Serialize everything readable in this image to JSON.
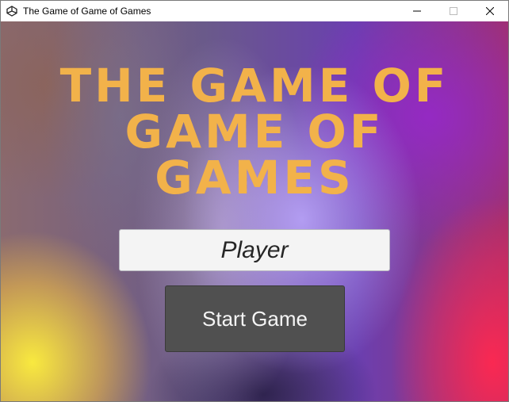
{
  "window": {
    "title": "The Game of Game of Games",
    "app_icon": "unity-icon",
    "controls": {
      "minimize_icon": "minimize-icon",
      "maximize_icon": "maximize-icon",
      "close_icon": "close-icon"
    }
  },
  "menu": {
    "title_lines": [
      "THE GAME OF",
      "GAME OF",
      "GAMES"
    ],
    "player_name_value": "Player",
    "start_button_label": "Start Game"
  },
  "colors": {
    "title_text": "#f2b24a",
    "button_bg": "#505050",
    "button_text": "#f5f5f5",
    "input_bg": "#f4f4f4",
    "input_text": "#262626"
  }
}
